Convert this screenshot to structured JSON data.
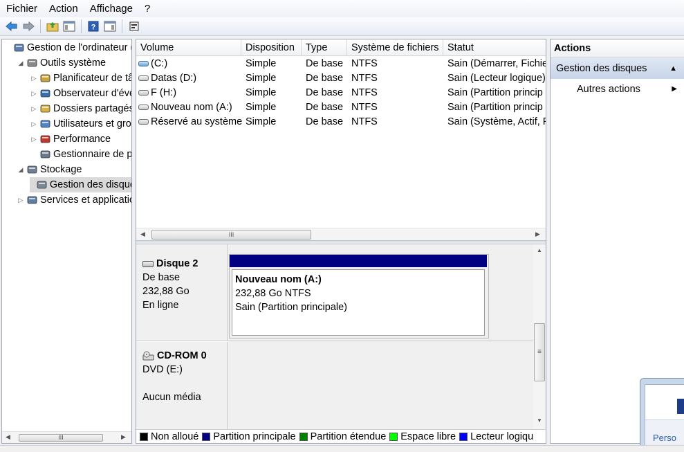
{
  "menu": [
    "Fichier",
    "Action",
    "Affichage",
    "?"
  ],
  "tree": {
    "items": [
      {
        "label": "Gestion de l'ordinateur (l",
        "indent": 0,
        "twisty": "",
        "icon": "computer-icon"
      },
      {
        "label": "Outils système",
        "indent": 1,
        "twisty": "◢",
        "icon": "tools-icon"
      },
      {
        "label": "Planificateur de tâc",
        "indent": 2,
        "twisty": "▷",
        "icon": "clock-icon"
      },
      {
        "label": "Observateur d'évér",
        "indent": 2,
        "twisty": "▷",
        "icon": "event-viewer-icon"
      },
      {
        "label": "Dossiers partagés",
        "indent": 2,
        "twisty": "▷",
        "icon": "shared-folder-icon"
      },
      {
        "label": "Utilisateurs et grou",
        "indent": 2,
        "twisty": "▷",
        "icon": "users-icon"
      },
      {
        "label": "Performance",
        "indent": 2,
        "twisty": "▷",
        "icon": "performance-icon"
      },
      {
        "label": "Gestionnaire de pé",
        "indent": 2,
        "twisty": "",
        "icon": "device-manager-icon"
      },
      {
        "label": "Stockage",
        "indent": 1,
        "twisty": "◢",
        "icon": "storage-icon"
      },
      {
        "label": "Gestion des disque",
        "indent": 2,
        "twisty": "",
        "icon": "disk-management-icon",
        "selected": true
      },
      {
        "label": "Services et application",
        "indent": 1,
        "twisty": "▷",
        "icon": "services-icon"
      }
    ]
  },
  "volumes": {
    "headers": [
      "Volume",
      "Disposition",
      "Type",
      "Système de fichiers",
      "Statut"
    ],
    "rows": [
      {
        "volume": "(C:)",
        "disposition": "Simple",
        "type": "De base",
        "fs": "NTFS",
        "status": "Sain (Démarrer, Fichie",
        "icon": "system-volume-icon"
      },
      {
        "volume": "Datas (D:)",
        "disposition": "Simple",
        "type": "De base",
        "fs": "NTFS",
        "status": "Sain (Lecteur logique)",
        "icon": "volume-icon"
      },
      {
        "volume": "F (H:)",
        "disposition": "Simple",
        "type": "De base",
        "fs": "NTFS",
        "status": "Sain (Partition princip",
        "icon": "volume-icon"
      },
      {
        "volume": "Nouveau nom (A:)",
        "disposition": "Simple",
        "type": "De base",
        "fs": "NTFS",
        "status": "Sain (Partition princip",
        "icon": "volume-icon"
      },
      {
        "volume": "Réservé au système",
        "disposition": "Simple",
        "type": "De base",
        "fs": "NTFS",
        "status": "Sain (Système, Actif, P",
        "icon": "volume-icon"
      }
    ]
  },
  "disks": [
    {
      "name": "Disque 2",
      "type": "De base",
      "size": "232,88 Go",
      "state": "En ligne",
      "partition": {
        "name": "Nouveau nom  (A:)",
        "size_fs": "232,88 Go NTFS",
        "status": "Sain (Partition principale)",
        "color": "#000080"
      }
    },
    {
      "name": "CD-ROM 0",
      "type": "DVD (E:)",
      "state": "Aucun média"
    }
  ],
  "legend": [
    {
      "label": "Non alloué",
      "color": "#000000"
    },
    {
      "label": "Partition principale",
      "color": "#000080"
    },
    {
      "label": "Partition étendue",
      "color": "#008000"
    },
    {
      "label": "Espace libre",
      "color": "#00ff00"
    },
    {
      "label": "Lecteur logiqu",
      "color": "#0000ff"
    }
  ],
  "actions": {
    "title": "Actions",
    "group": "Gestion des disques",
    "item": "Autres actions"
  },
  "popup": {
    "text": "Perso"
  },
  "scroll_glyph": "III",
  "scroll_glyph_v": "≡"
}
